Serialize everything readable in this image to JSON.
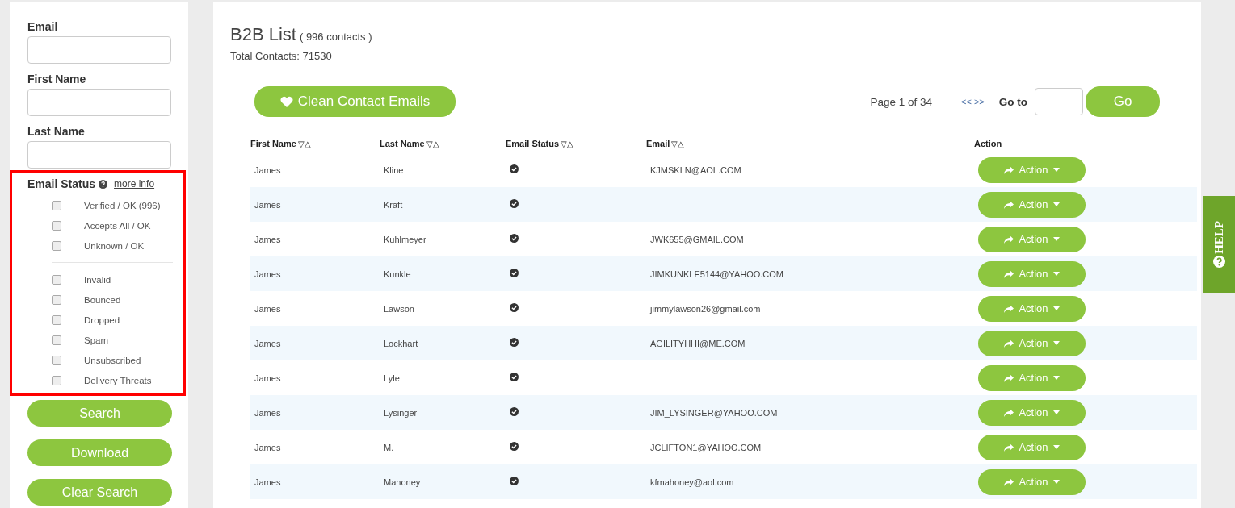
{
  "sidebar": {
    "fields": [
      {
        "label": "Email"
      },
      {
        "label": "First Name"
      },
      {
        "label": "Last Name"
      }
    ],
    "email_status": {
      "label": "Email Status",
      "link": "more info",
      "groups": [
        [
          {
            "label": "Verified / OK (996)",
            "checked": false
          },
          {
            "label": "Accepts All / OK",
            "checked": false
          },
          {
            "label": "Unknown / OK",
            "checked": false
          }
        ],
        [
          {
            "label": "Invalid",
            "checked": false
          },
          {
            "label": "Bounced",
            "checked": false
          },
          {
            "label": "Dropped",
            "checked": false
          },
          {
            "label": "Spam",
            "checked": false
          },
          {
            "label": "Unsubscribed",
            "checked": false
          },
          {
            "label": "Delivery Threats",
            "checked": false
          }
        ]
      ]
    },
    "buttons": [
      "Search",
      "Download",
      "Clear Search"
    ]
  },
  "main": {
    "title": "B2B List",
    "count": "( 996 contacts )",
    "total": "Total Contacts: 71530",
    "clean_button": "Clean Contact Emails",
    "pagination": {
      "page": "Page 1 of 34",
      "prev": "<<",
      "next": ">>",
      "goto_label": "Go to",
      "go_button": "Go"
    },
    "table": {
      "columns": [
        {
          "label": "First Name",
          "sort": "▽△"
        },
        {
          "label": "Last Name",
          "sort": "▽△"
        },
        {
          "label": "Email Status",
          "sort": "▽△"
        },
        {
          "label": "Email",
          "sort": "▽△"
        },
        {
          "label": "Action"
        }
      ],
      "rows": [
        {
          "first": "James",
          "last": "Kline",
          "email": "KJMSKLN@AOL.COM",
          "verified": true,
          "action": "Action"
        },
        {
          "first": "James",
          "last": "Kraft",
          "email": "",
          "verified": true,
          "action": "Action"
        },
        {
          "first": "James",
          "last": "Kuhlmeyer",
          "email": "JWK655@GMAIL.COM",
          "verified": true,
          "action": "Action"
        },
        {
          "first": "James",
          "last": "Kunkle",
          "email": "JIMKUNKLE5144@YAHOO.COM",
          "verified": true,
          "action": "Action"
        },
        {
          "first": "James",
          "last": "Lawson",
          "email": "jimmylawson26@gmail.com",
          "verified": true,
          "action": "Action"
        },
        {
          "first": "James",
          "last": "Lockhart",
          "email": "AGILITYHHI@ME.COM",
          "verified": true,
          "action": "Action"
        },
        {
          "first": "James",
          "last": "Lyle",
          "email": "",
          "verified": true,
          "action": "Action"
        },
        {
          "first": "James",
          "last": "Lysinger",
          "email": "JIM_LYSINGER@YAHOO.COM",
          "verified": true,
          "action": "Action"
        },
        {
          "first": "James",
          "last": "M.",
          "email": "JCLIFTON1@YAHOO.COM",
          "verified": true,
          "action": "Action"
        },
        {
          "first": "James",
          "last": "Mahoney",
          "email": "kfmahoney@aol.com",
          "verified": true,
          "action": "Action"
        }
      ]
    }
  },
  "help_tab": {
    "label": "HELP"
  }
}
